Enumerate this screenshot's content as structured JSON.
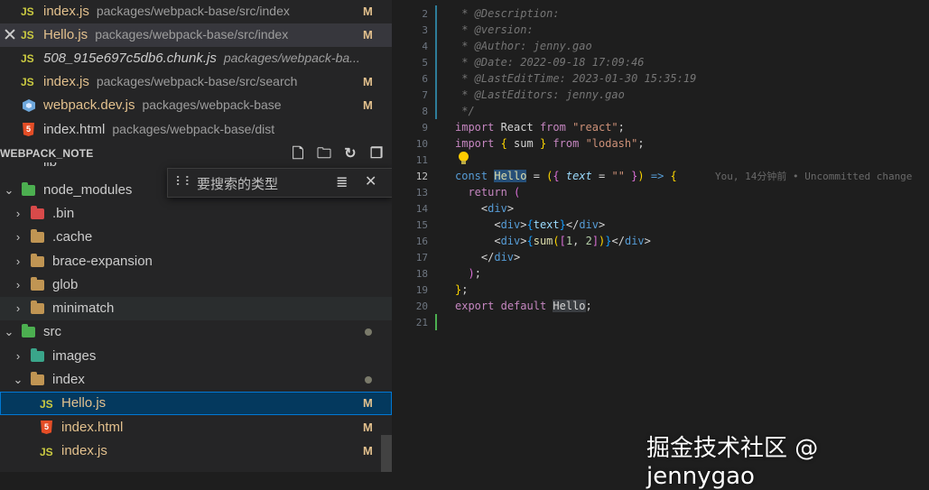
{
  "open_editors": [
    {
      "name": "index.js",
      "path": "packages/webpack-base/src/index",
      "badge": "M",
      "icon": "js-icon"
    },
    {
      "name": "Hello.js",
      "path": "packages/webpack-base/src/index",
      "badge": "M",
      "icon": "js-icon",
      "active": true
    },
    {
      "name": "508_915e697c5db6.chunk.js",
      "path": "packages/webpack-ba...",
      "badge": "",
      "icon": "js-icon"
    },
    {
      "name": "index.js",
      "path": "packages/webpack-base/src/search",
      "badge": "M",
      "icon": "js-icon"
    },
    {
      "name": "webpack.dev.js",
      "path": "packages/webpack-base",
      "badge": "M",
      "icon": "webpack-icon"
    },
    {
      "name": "index.html",
      "path": "packages/webpack-base/dist",
      "badge": "",
      "icon": "html-icon"
    }
  ],
  "explorer": {
    "title": "WEBPACK_NOTE",
    "partial_item": "lib",
    "filter_placeholder": "要搜索的类型",
    "tree": [
      {
        "label": "node_modules",
        "chevron": "down",
        "folder": "green"
      },
      {
        "label": ".bin",
        "chevron": "right",
        "folder": "red"
      },
      {
        "label": ".cache",
        "chevron": "right",
        "folder": "plain"
      },
      {
        "label": "brace-expansion",
        "chevron": "right",
        "folder": "plain"
      },
      {
        "label": "glob",
        "chevron": "right",
        "folder": "plain"
      },
      {
        "label": "minimatch",
        "chevron": "right",
        "folder": "plain"
      },
      {
        "label": "src",
        "chevron": "down",
        "folder": "green",
        "badge": "dot"
      },
      {
        "label": "images",
        "chevron": "right",
        "folder": "teal"
      },
      {
        "label": "index",
        "chevron": "down",
        "folder": "plain",
        "badge": "dot"
      },
      {
        "label": "Hello.js",
        "file": "js",
        "badge": "M",
        "selected": true
      },
      {
        "label": "index.html",
        "file": "html",
        "badge": "M"
      },
      {
        "label": "index.js",
        "file": "js",
        "badge": "M"
      }
    ]
  },
  "editor": {
    "line_numbers": [
      "2",
      "3",
      "4",
      "5",
      "6",
      "7",
      "8",
      "9",
      "10",
      "11",
      "12",
      "13",
      "14",
      "15",
      "16",
      "17",
      "18",
      "19",
      "20",
      "21"
    ],
    "current_line": "12",
    "comments": [
      " * @Description:",
      " * @version:",
      " * @Author: jenny.gao",
      " * @Date: 2022-09-18 17:09:46",
      " * @LastEditTime: 2023-01-30 15:35:19",
      " * @LastEditors: jenny.gao",
      " */"
    ],
    "blame": "You, 14分钟前 • Uncommitted change"
  },
  "watermark": "掘金技术社区 @ jennygao"
}
